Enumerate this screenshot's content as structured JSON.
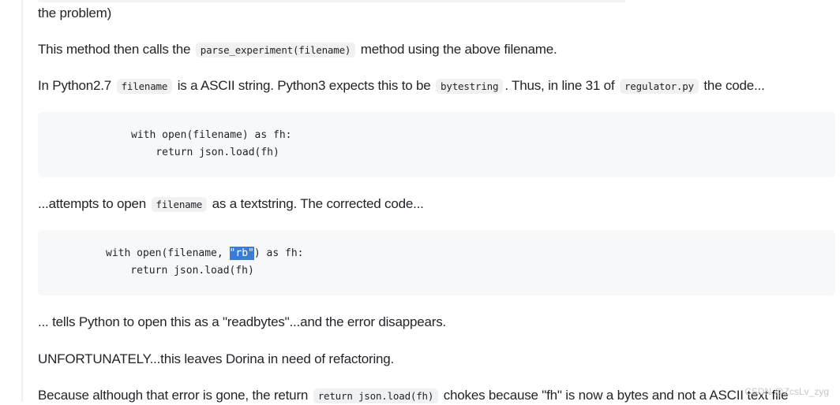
{
  "paragraphs": {
    "p0": "the problem)",
    "p1_pre": "This method then calls the ",
    "p1_code": "parse_experiment(filename)",
    "p1_post": " method using the above filename.",
    "p2_pre": "In Python2.7 ",
    "p2_code1": "filename",
    "p2_mid1": " is a ASCII string. Python3 expects this to be ",
    "p2_code2": "bytestring",
    "p2_mid2": ". Thus, in line 31 of ",
    "p2_code3": "regulator.py",
    "p2_post": " the code...",
    "p3_pre": "...attempts to open ",
    "p3_code": "filename",
    "p3_post": " as a textstring. The corrected code...",
    "p4": "... tells Python to open this as a \"readbytes\"...and the error disappears.",
    "p5": "UNFORTUNATELY...this leaves Dorina in need of refactoring.",
    "p6_pre": "Because although that error is gone, the return ",
    "p6_code": "return json.load(fh)",
    "p6_post": " chokes because \"fh\" is now a bytes and not a ASCII text file"
  },
  "code1": {
    "line1": "with open(filename) as fh:",
    "line2": "    return json.load(fh)"
  },
  "code2": {
    "line1_pre": "with open(filename, ",
    "line1_hl": "\"rb\"",
    "line1_post": ") as fh:",
    "line2": "    return json.load(fh)"
  },
  "watermark": "CSDN @ZcsLv_zyg"
}
